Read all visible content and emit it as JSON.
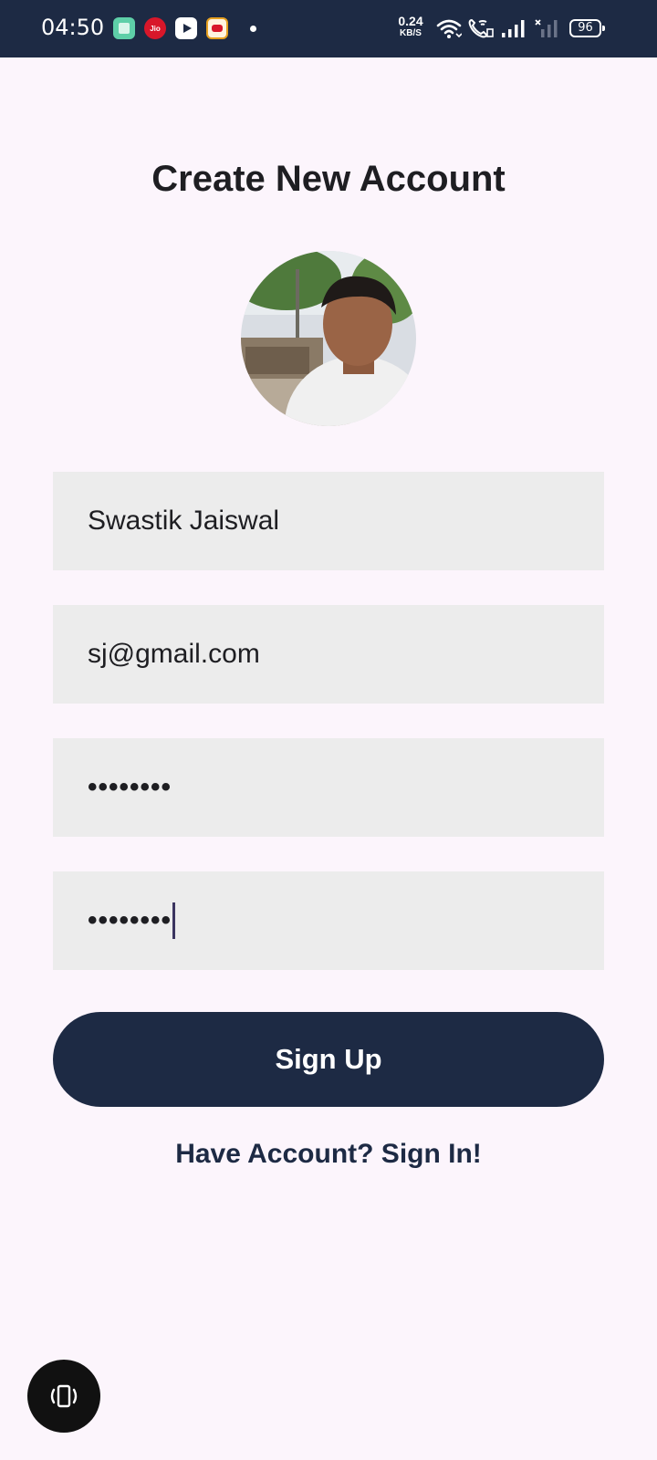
{
  "status_bar": {
    "time": "04:50",
    "network_speed_value": "0.24",
    "network_speed_unit": "KB/S",
    "battery": "96",
    "app_icons": [
      "gallery-icon",
      "jio-icon",
      "youtube-icon",
      "game-icon"
    ],
    "jio_label": "Jio"
  },
  "page": {
    "title": "Create New Account"
  },
  "form": {
    "name_value": "Swastik Jaiswal",
    "email_value": "sj@gmail.com",
    "password_value": "••••••••",
    "confirm_password_value": "••••••••"
  },
  "buttons": {
    "signup_label": "Sign Up",
    "signin_link_label": "Have Account? Sign In!"
  },
  "colors": {
    "background": "#fcf5fc",
    "primary": "#1d2a44",
    "field_background": "#ececec"
  }
}
